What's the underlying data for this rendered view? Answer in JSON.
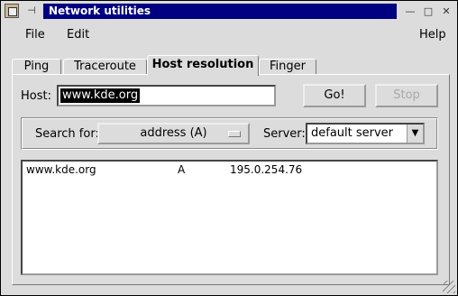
{
  "window": {
    "title": "Network utilities",
    "pin_glyph": "⊣",
    "minimize_glyph": "—",
    "maximize_glyph": "□",
    "close_glyph": "✕"
  },
  "menu": {
    "file": "File",
    "edit": "Edit",
    "help": "Help"
  },
  "tabs": [
    {
      "label": "Ping",
      "active": false
    },
    {
      "label": "Traceroute",
      "active": false
    },
    {
      "label": "Host resolution",
      "active": true
    },
    {
      "label": "Finger",
      "active": false
    }
  ],
  "host": {
    "label": "Host:",
    "value": "www.kde.org",
    "go_label": "Go!",
    "stop_label": "Stop"
  },
  "search": {
    "label": "Search for:",
    "selected": "address (A)",
    "server_label": "Server:",
    "server_value": "default server"
  },
  "results": [
    {
      "name": "www.kde.org",
      "type": "A",
      "value": "195.0.254.76"
    }
  ]
}
